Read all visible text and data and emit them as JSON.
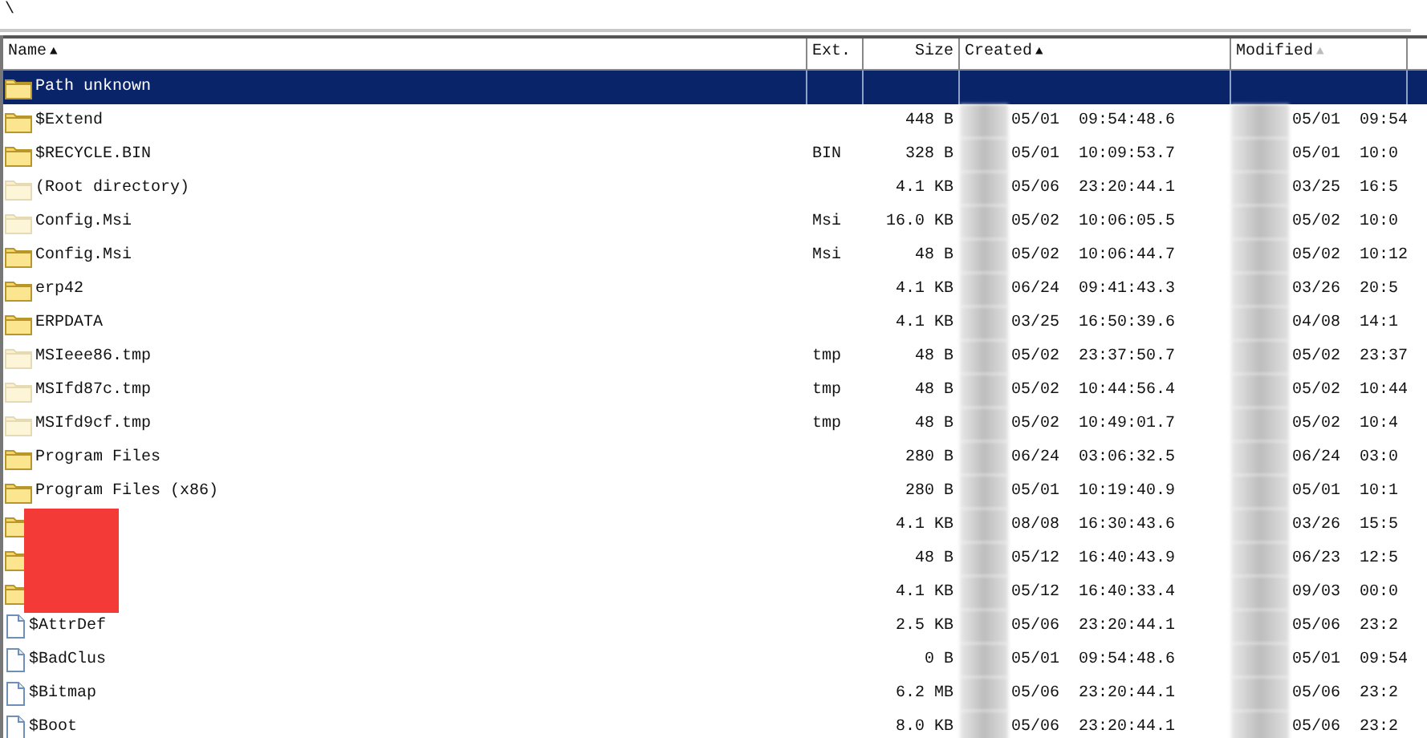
{
  "path_bar": {
    "text": "\\"
  },
  "columns": [
    {
      "label": "Name",
      "sort_arrow": "▲",
      "active": true
    },
    {
      "label": "Ext."
    },
    {
      "label": "Size"
    },
    {
      "label": "Created",
      "sort_arrow": "▲",
      "active": true
    },
    {
      "label": "Modified",
      "sort_arrow": "▲",
      "active": false
    }
  ],
  "rows": [
    {
      "kind": "folder",
      "name": "Path unknown",
      "selected": true
    },
    {
      "kind": "folder",
      "name": "$Extend",
      "size": "448 B",
      "created": "05/01  09:54:48.6",
      "modified": "05/01  09:54",
      "selected": false
    },
    {
      "kind": "folder",
      "name": "$RECYCLE.BIN",
      "ext": "BIN",
      "size": "328 B",
      "created": "05/01  10:09:53.7",
      "modified": "05/01  10:0",
      "selected": false
    },
    {
      "kind": "ghost",
      "name": "(Root directory)",
      "size": "4.1 KB",
      "created": "05/06  23:20:44.1",
      "modified": "03/25  16:5",
      "selected": false
    },
    {
      "kind": "ghost",
      "name": "Config.Msi",
      "ext": "Msi",
      "size": "16.0 KB",
      "created": "05/02  10:06:05.5",
      "modified": "05/02  10:0",
      "selected": false
    },
    {
      "kind": "folder",
      "name": "Config.Msi",
      "ext": "Msi",
      "size": "48 B",
      "created": "05/02  10:06:44.7",
      "modified": "05/02  10:12",
      "selected": false
    },
    {
      "kind": "folder",
      "name": "erp42",
      "size": "4.1 KB",
      "created": "06/24  09:41:43.3",
      "modified": "03/26  20:5",
      "selected": false
    },
    {
      "kind": "folder",
      "name": "ERPDATA",
      "size": "4.1 KB",
      "created": "03/25  16:50:39.6",
      "modified": "04/08  14:1",
      "selected": false
    },
    {
      "kind": "ghost",
      "name": "MSIeee86.tmp",
      "ext": "tmp",
      "size": "48 B",
      "created": "05/02  23:37:50.7",
      "modified": "05/02  23:37",
      "selected": false
    },
    {
      "kind": "ghost",
      "name": "MSIfd87c.tmp",
      "ext": "tmp",
      "size": "48 B",
      "created": "05/02  10:44:56.4",
      "modified": "05/02  10:44",
      "selected": false
    },
    {
      "kind": "ghost",
      "name": "MSIfd9cf.tmp",
      "ext": "tmp",
      "size": "48 B",
      "created": "05/02  10:49:01.7",
      "modified": "05/02  10:4",
      "selected": false
    },
    {
      "kind": "folder",
      "name": "Program Files",
      "size": "280 B",
      "created": "06/24  03:06:32.5",
      "modified": "06/24  03:0",
      "selected": false
    },
    {
      "kind": "folder",
      "name": "Program Files (x86)",
      "size": "280 B",
      "created": "05/01  10:19:40.9",
      "modified": "05/01  10:1",
      "selected": false
    },
    {
      "kind": "folder",
      "size": "4.1 KB",
      "created": "08/08  16:30:43.6",
      "modified": "03/26  15:5",
      "selected": false
    },
    {
      "kind": "folder",
      "size": "48 B",
      "created": "05/12  16:40:43.9",
      "modified": "06/23  12:5",
      "selected": false
    },
    {
      "kind": "folder",
      "size": "4.1 KB",
      "created": "05/12  16:40:33.4",
      "modified": "09/03  00:0",
      "selected": false
    },
    {
      "kind": "file",
      "name": "$AttrDef",
      "size": "2.5 KB",
      "created": "05/06  23:20:44.1",
      "modified": "05/06  23:2",
      "selected": false
    },
    {
      "kind": "file",
      "name": "$BadClus",
      "size": "0 B",
      "created": "05/01  09:54:48.6",
      "modified": "05/01  09:54",
      "selected": false
    },
    {
      "kind": "file",
      "name": "$Bitmap",
      "size": "6.2 MB",
      "created": "05/06  23:20:44.1",
      "modified": "05/06  23:2",
      "selected": false
    },
    {
      "kind": "file",
      "name": "$Boot",
      "size": "8.0 KB",
      "created": "05/06  23:20:44.1",
      "modified": "05/06  23:2",
      "selected": false
    }
  ]
}
